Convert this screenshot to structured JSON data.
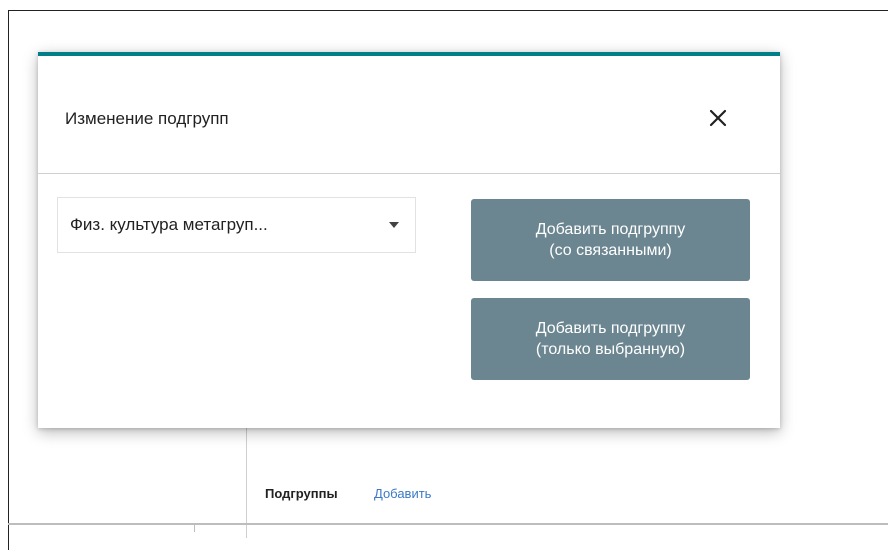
{
  "page": {
    "subgroups_label": "Подгруппы",
    "add_link": "Добавить"
  },
  "modal": {
    "title": "Изменение подгрупп",
    "close_icon": "close-icon",
    "accent_color": "#007f86",
    "select": {
      "value": "Физ. культура метагруп...",
      "icon": "chevron-down-icon"
    },
    "buttons": [
      {
        "line1": "Добавить подгруппу",
        "line2": "(со связанными)"
      },
      {
        "line1": "Добавить подгруппу",
        "line2": "(только выбранную)"
      }
    ],
    "button_color": "#6b8691"
  }
}
